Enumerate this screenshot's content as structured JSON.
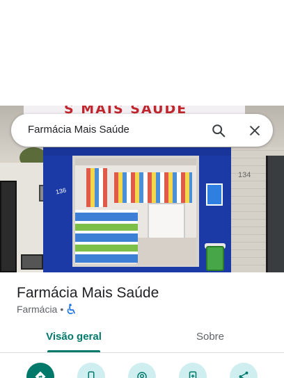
{
  "search": {
    "query": "Farmácia Mais Saúde"
  },
  "photo": {
    "sign_text": "S MAIS SAÚDE",
    "house_number_left": "136",
    "house_number_right": "134"
  },
  "place": {
    "name": "Farmácia Mais Saúde",
    "category": "Farmácia",
    "separator": "•"
  },
  "tabs": [
    {
      "label": "Visão geral",
      "selected": true
    },
    {
      "label": "Sobre",
      "selected": false
    }
  ],
  "actions": [
    {
      "icon": "directions-icon"
    },
    {
      "icon": "phone-icon"
    },
    {
      "icon": "nearby-icon"
    },
    {
      "icon": "save-icon"
    },
    {
      "icon": "share-icon"
    }
  ],
  "colors": {
    "accent": "#00796b",
    "action_bg": "#cfeef0",
    "accessibility": "#1a73e8"
  }
}
